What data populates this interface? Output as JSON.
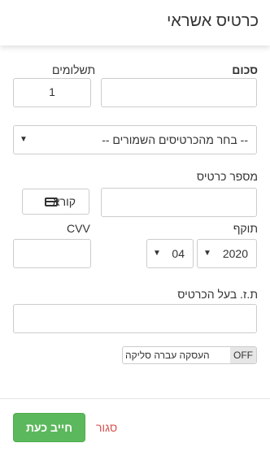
{
  "header": {
    "title": "כרטיס אשראי"
  },
  "form": {
    "amount": {
      "label": "סכום",
      "value": ""
    },
    "installments": {
      "label": "תשלומים",
      "value": "1"
    },
    "saved_cards": {
      "selected": "-- בחר מהכרטיסים השמורים --"
    },
    "card_number": {
      "label": "מספר כרטיס",
      "value": "",
      "reader_button": "קורא"
    },
    "expiry": {
      "label": "תוקף",
      "year": "2020",
      "month": "04"
    },
    "cvv": {
      "label": "CVV",
      "value": ""
    },
    "id_number": {
      "label": "ת.ז. בעל הכרטיס",
      "value": ""
    },
    "toggle": {
      "state": "OFF",
      "label": "העסקה עברה סליקה"
    }
  },
  "footer": {
    "charge_label": "חייב כעת",
    "close_label": "סגור"
  }
}
